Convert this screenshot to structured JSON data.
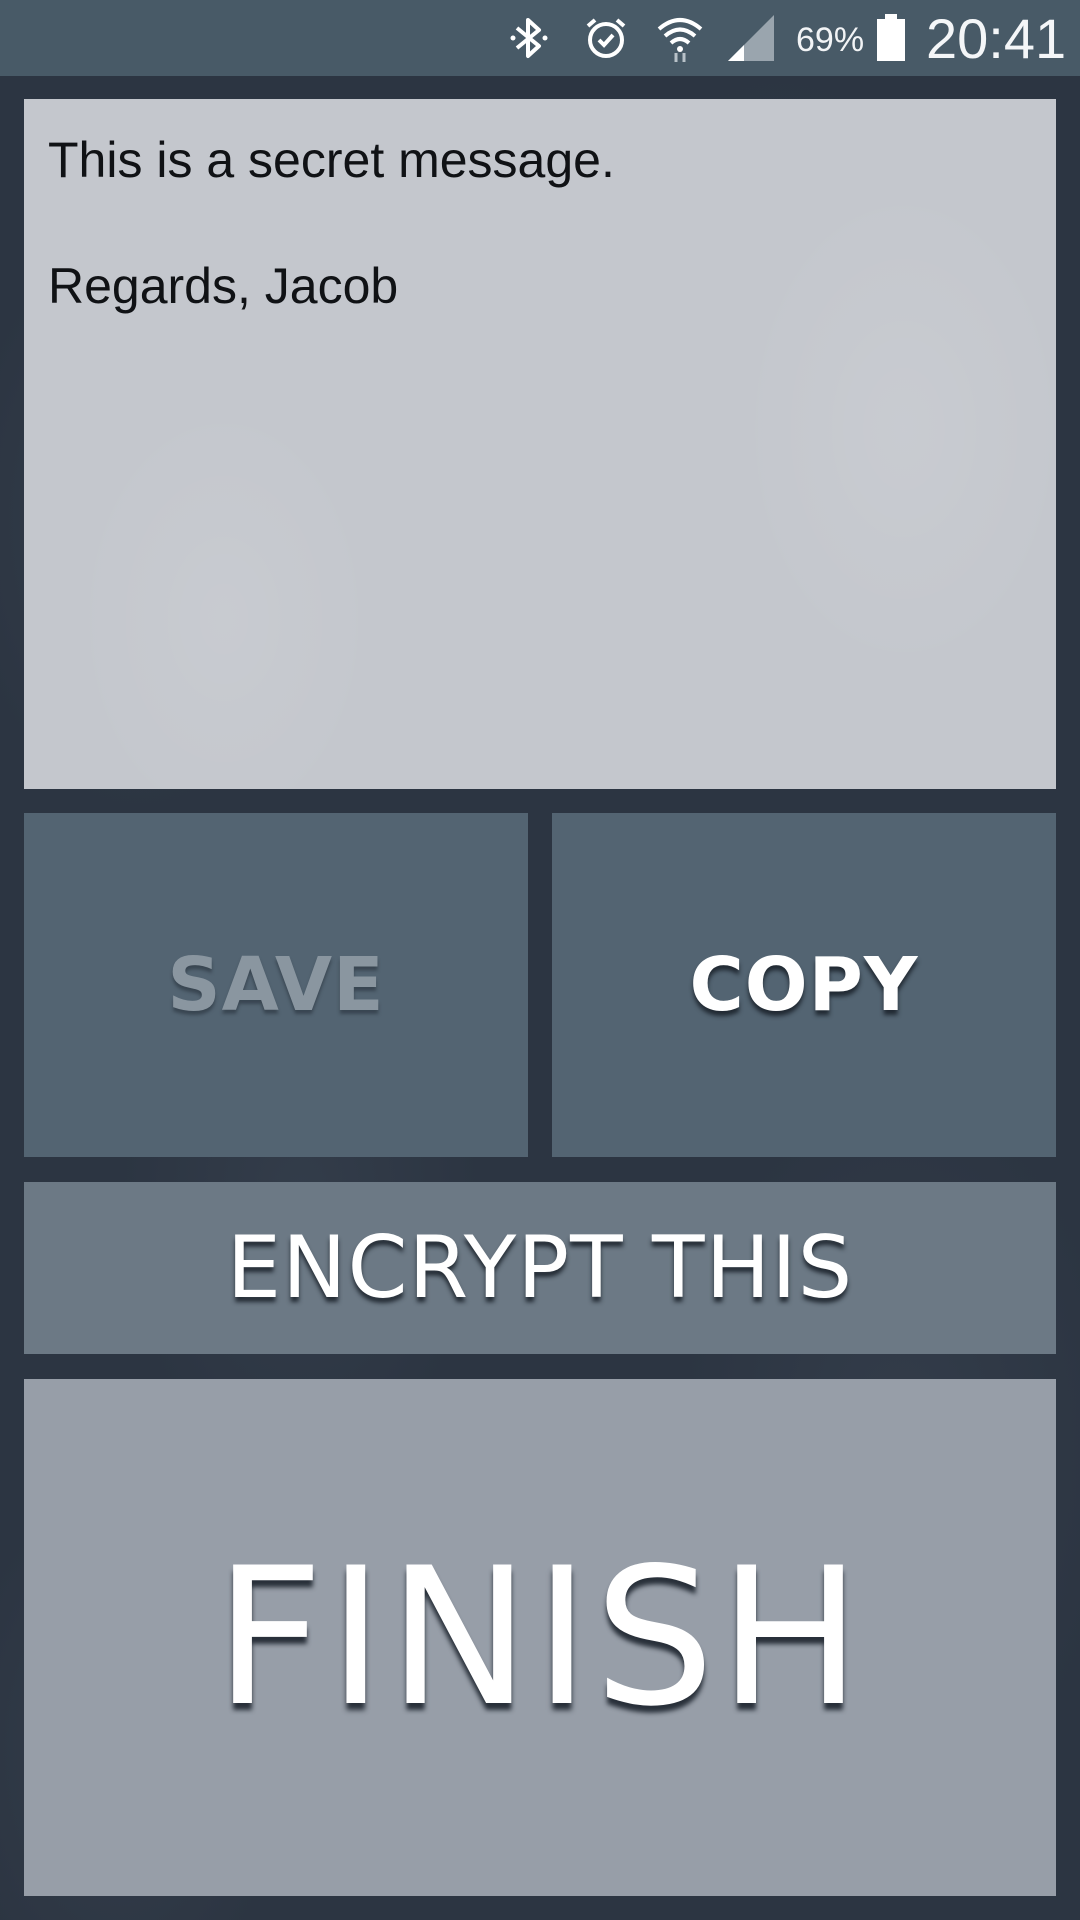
{
  "status_bar": {
    "icons": [
      "bluetooth-icon",
      "alarm-icon",
      "wifi-icon",
      "signal-icon",
      "battery-icon"
    ],
    "battery_percent": "69%",
    "time": "20:41"
  },
  "message": {
    "text": "This is a secret message.\n\nRegards, Jacob"
  },
  "buttons": {
    "save_label": "SAVE",
    "copy_label": "COPY",
    "encrypt_label": "ENCRYPT THIS",
    "finish_label": "FINISH"
  },
  "colors": {
    "background": "#2c3542",
    "status_bar": "#485a67",
    "message_area": "#c4c7cd",
    "save_copy_buttons": "#536472",
    "encrypt_button": "#6c7985",
    "finish_button": "#979ea8",
    "disabled_text": "#8a96a0"
  }
}
